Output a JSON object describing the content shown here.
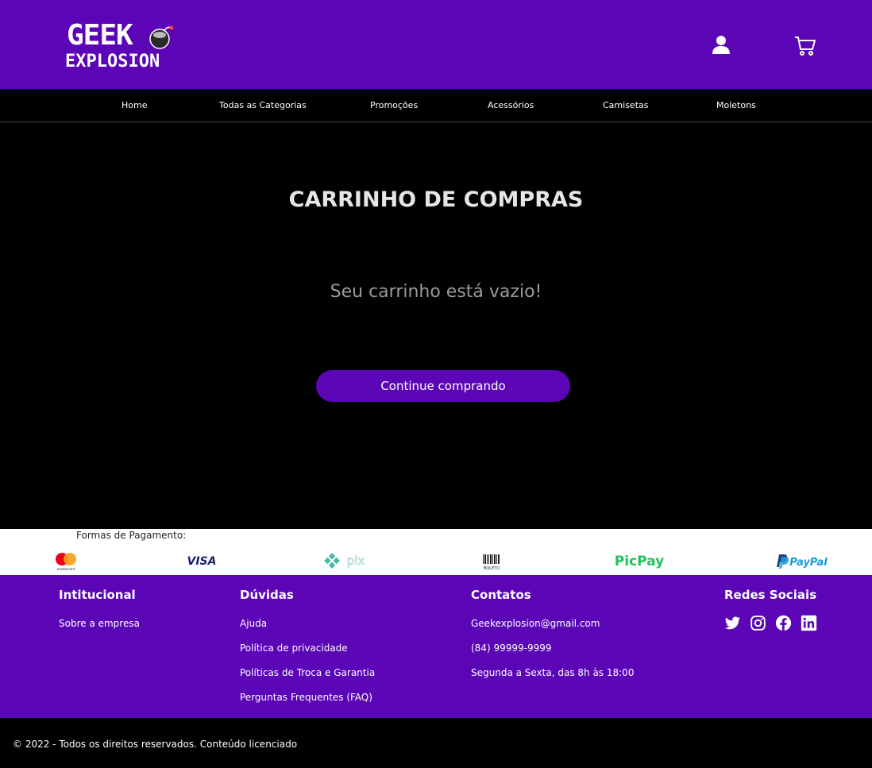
{
  "brand": {
    "line1": "GEEK",
    "line2": "EXPLOSION"
  },
  "header": {
    "account_icon": "user-icon",
    "cart_icon": "cart-icon"
  },
  "nav": {
    "items": [
      "Home",
      "Todas as Categorias",
      "Promoções",
      "Acessórios",
      "Camisetas",
      "Moletons"
    ]
  },
  "cart": {
    "title": "CARRINHO DE COMPRAS",
    "empty_message": "Seu carrinho está vazio!",
    "continue_label": "Continue comprando"
  },
  "payments": {
    "title": "Formas de Pagamento:",
    "methods": [
      "mastercard",
      "VISA",
      "pix",
      "BOLETO",
      "PicPay",
      "PayPal"
    ]
  },
  "footer": {
    "institutional": {
      "title": "Intitucional",
      "links": [
        "Sobre a empresa"
      ]
    },
    "doubts": {
      "title": "Dúvidas",
      "links": [
        "Ajuda",
        "Política de privacidade",
        "Políticas de Troca e Garantia",
        "Perguntas Frequentes (FAQ)"
      ]
    },
    "contacts": {
      "title": "Contatos",
      "items": [
        "Geekexplosion@gmail.com",
        "(84) 99999-9999",
        "Segunda a Sexta, das 8h às 18:00"
      ]
    },
    "social": {
      "title": "Redes Sociais",
      "icons": [
        "twitter-icon",
        "instagram-icon",
        "facebook-icon",
        "linkedin-icon"
      ]
    }
  },
  "copyright": "© 2022 - Todos os direitos reservados. Conteúdo licenciado",
  "colors": {
    "brand_purple": "#5b05b7",
    "background": "#000000",
    "title_gray": "#e6e6e6",
    "message_gray": "#9a9a9a"
  }
}
